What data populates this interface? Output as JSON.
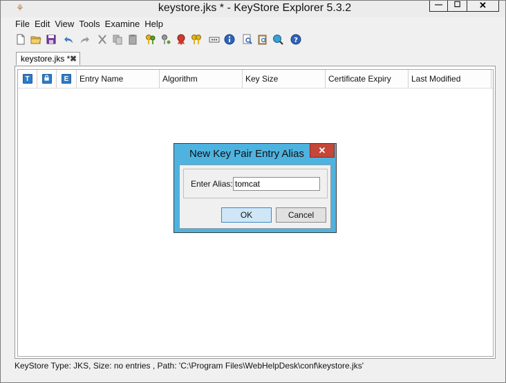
{
  "window": {
    "title": "keystore.jks * - KeyStore Explorer 5.3.2",
    "controls": {
      "minimize": "—",
      "maximize": "☐",
      "close": "✕"
    }
  },
  "menu": [
    "File",
    "Edit",
    "View",
    "Tools",
    "Examine",
    "Help"
  ],
  "toolbar": {
    "icons": [
      "new-file-icon",
      "open-folder-icon",
      "save-icon",
      "undo-icon",
      "redo-icon",
      "cut-icon",
      "copy-icon",
      "paste-icon",
      "generate-key-pair-icon",
      "generate-secret-key-icon",
      "import-trusted-certificate-icon",
      "import-key-pair-icon",
      "set-password-icon",
      "properties-icon",
      "examine-file-icon",
      "examine-clipboard-icon",
      "examine-ssl-icon",
      "help-icon"
    ]
  },
  "tab": {
    "label": "keystore.jks *",
    "close": "✖"
  },
  "table": {
    "icon_columns": [
      {
        "glyph": "T",
        "icon": "entry-type-icon"
      },
      {
        "glyph": "",
        "icon": "lock-status-icon"
      },
      {
        "glyph": "E",
        "icon": "expiry-status-icon"
      }
    ],
    "columns": [
      "Entry Name",
      "Algorithm",
      "Key Size",
      "Certificate Expiry",
      "Last Modified"
    ]
  },
  "status": "KeyStore Type: JKS, Size: no entries , Path: 'C:\\Program Files\\WebHelpDesk\\conf\\keystore.jks'",
  "dialog": {
    "title": "New Key Pair Entry Alias",
    "close": "✕",
    "alias_label": "Enter Alias:",
    "alias_value": "tomcat",
    "ok": "OK",
    "cancel": "Cancel"
  },
  "colors": {
    "dialog_frame": "#4fb3e0",
    "close_button": "#c4473a",
    "header_badge": "#2e7bc7"
  }
}
